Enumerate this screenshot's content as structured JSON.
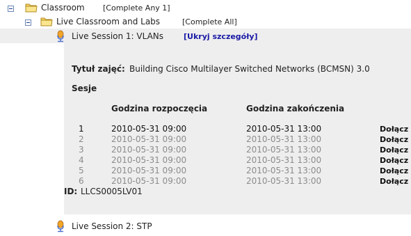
{
  "tree": {
    "classroom": {
      "label": "Classroom",
      "mode": "[Complete Any 1]"
    },
    "live_classroom": {
      "label": "Live Classroom and Labs",
      "mode": "[Complete All]"
    },
    "session1": {
      "label": "Live Session 1: VLANs",
      "toggle_link": "[Ukryj szczegóły]"
    },
    "session2": {
      "label": "Live Session 2: STP"
    }
  },
  "details": {
    "title_label": "Tytuł zajęć:",
    "title_value": "Building Cisco Multilayer Switched Networks (BCMSN) 3.0",
    "sessions_heading": "Sesje",
    "col_start": "Godzina rozpoczęcia",
    "col_end": "Godzina zakończenia",
    "rows": [
      {
        "num": "1",
        "start": "2010-05-31 09:00",
        "end": "2010-05-31 13:00",
        "action": "Dołącz"
      },
      {
        "num": "2",
        "start": "2010-05-31 09:00",
        "end": "2010-05-31 13:00",
        "action": "Dołącz"
      },
      {
        "num": "3",
        "start": "2010-05-31 09:00",
        "end": "2010-05-31 13:00",
        "action": "Dołącz"
      },
      {
        "num": "4",
        "start": "2010-05-31 09:00",
        "end": "2010-05-31 13:00",
        "action": "Dołącz"
      },
      {
        "num": "5",
        "start": "2010-05-31 09:00",
        "end": "2010-05-31 13:00",
        "action": "Dołącz"
      },
      {
        "num": "6",
        "start": "2010-05-31 09:00",
        "end": "2010-05-31 13:00",
        "action": "Dołącz"
      }
    ],
    "id_label": "ID:",
    "id_value": "LLCS0005LV01"
  },
  "colors": {
    "folder": "#f3d46a",
    "highlight": "#eeeeee",
    "link": "#1a1aa6",
    "inactive": "#8c8c8c"
  },
  "icons": [
    "collapse-icon",
    "folder-icon",
    "microphone-icon"
  ]
}
